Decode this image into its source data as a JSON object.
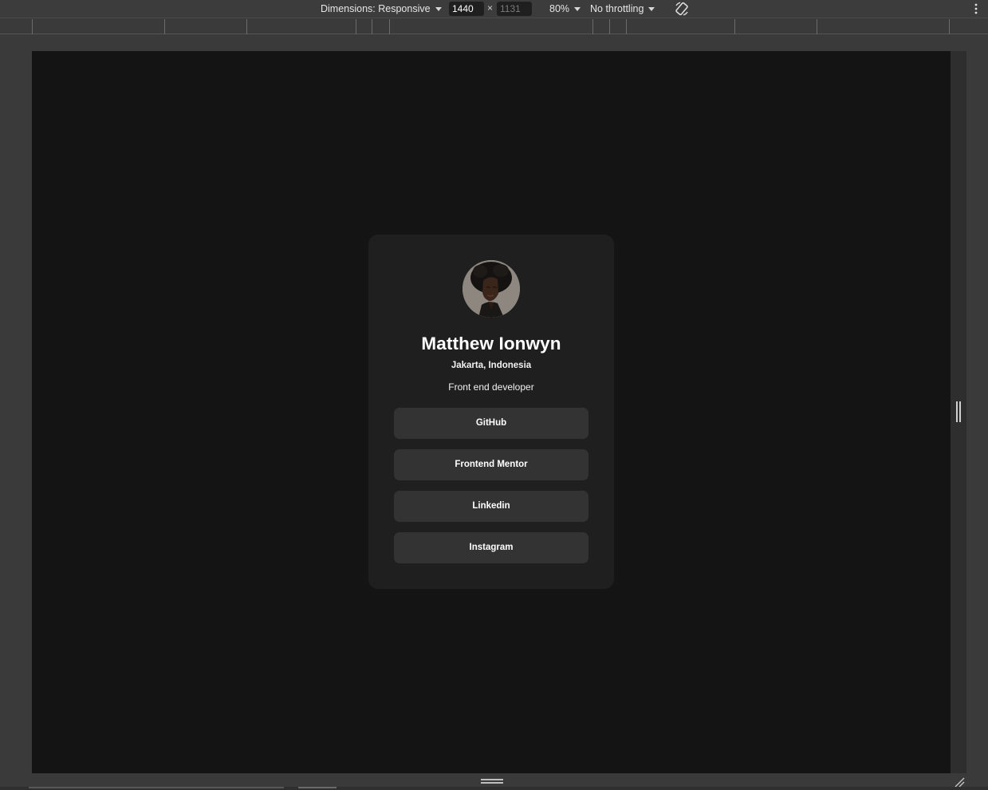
{
  "devtools": {
    "dimensions_label": "Dimensions: Responsive",
    "width_value": "1440",
    "height_value": "1131",
    "times_symbol": "×",
    "zoom": "80%",
    "throttling": "No throttling",
    "icons": [
      "rotate-icon",
      "kebab-menu-icon",
      "caret-down-icon",
      "resize-handle-icon"
    ]
  },
  "profile": {
    "avatar_alt": "Matthew Ionwyn",
    "name": "Matthew Ionwyn",
    "location": "Jakarta, Indonesia",
    "bio": "Front end developer",
    "links": [
      {
        "label": "GitHub"
      },
      {
        "label": "Frontend Mentor"
      },
      {
        "label": "Linkedin"
      },
      {
        "label": "Instagram"
      }
    ]
  },
  "colors": {
    "page_background": "#141414",
    "card_background": "#1f1f1f",
    "button_background": "#333333",
    "text": "#ffffff",
    "devtools_chrome": "#3c3c3c"
  }
}
